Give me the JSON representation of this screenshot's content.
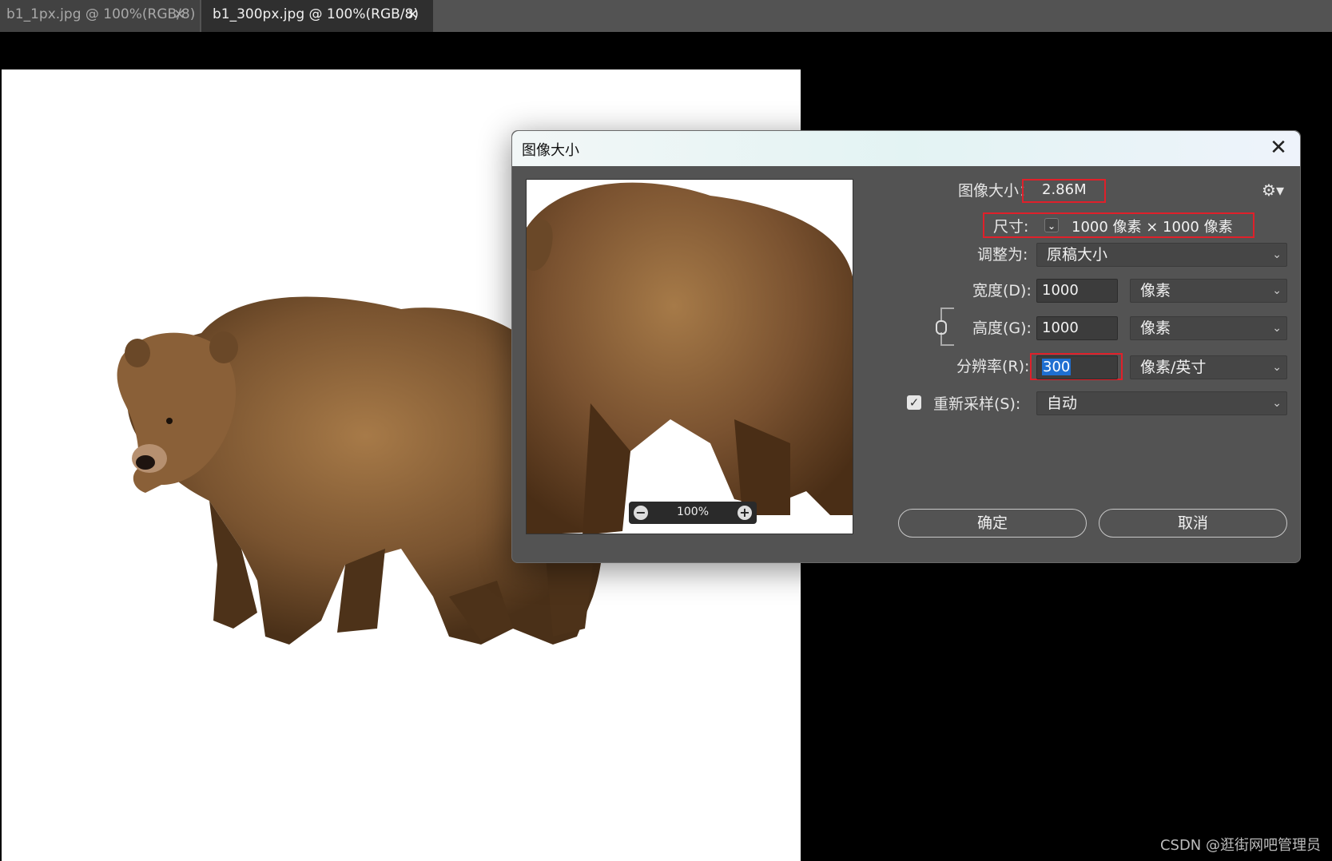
{
  "tabs": [
    {
      "label": "b1_1px.jpg @ 100%(RGB/8)",
      "close": "×"
    },
    {
      "label": "b1_300px.jpg @ 100%(RGB/8)",
      "close": "×"
    }
  ],
  "dialog": {
    "title": "图像大小",
    "close": "✕",
    "preview_zoom": "100%",
    "image_size_label": "图像大小：",
    "image_size_value": "2.86M",
    "dimensions_label": "尺寸:",
    "dimensions_value": "1000 像素  ×  1000 像素",
    "fit_to_label": "调整为:",
    "fit_to_value": "原稿大小",
    "width_label": "宽度(D):",
    "width_value": "1000",
    "width_unit": "像素",
    "height_label": "高度(G):",
    "height_value": "1000",
    "height_unit": "像素",
    "resolution_label": "分辨率(R):",
    "resolution_value": "300",
    "resolution_unit": "像素/英寸",
    "resample_label": "重新采样(S):",
    "resample_value": "自动",
    "resample_checked": true,
    "ok_label": "确定",
    "cancel_label": "取消"
  },
  "watermark": "CSDN @逛街网吧管理员"
}
